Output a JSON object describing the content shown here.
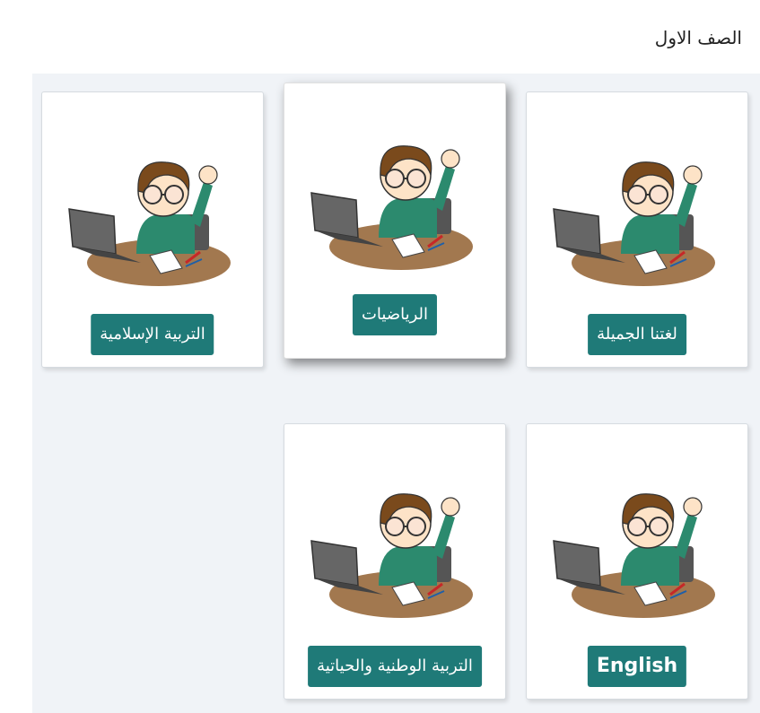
{
  "page": {
    "title": "الصف الاول"
  },
  "subjects": [
    {
      "label": "لغتنا الجميلة"
    },
    {
      "label": "الرياضيات"
    },
    {
      "label": "التربية الإسلامية"
    },
    {
      "label": "English"
    },
    {
      "label": "التربية الوطنية والحياتية"
    }
  ],
  "colors": {
    "button": "#1f7a78",
    "background": "#f0f3f7",
    "card": "#ffffff"
  },
  "icons": {
    "card_illustration": "student-at-laptop-icon"
  }
}
